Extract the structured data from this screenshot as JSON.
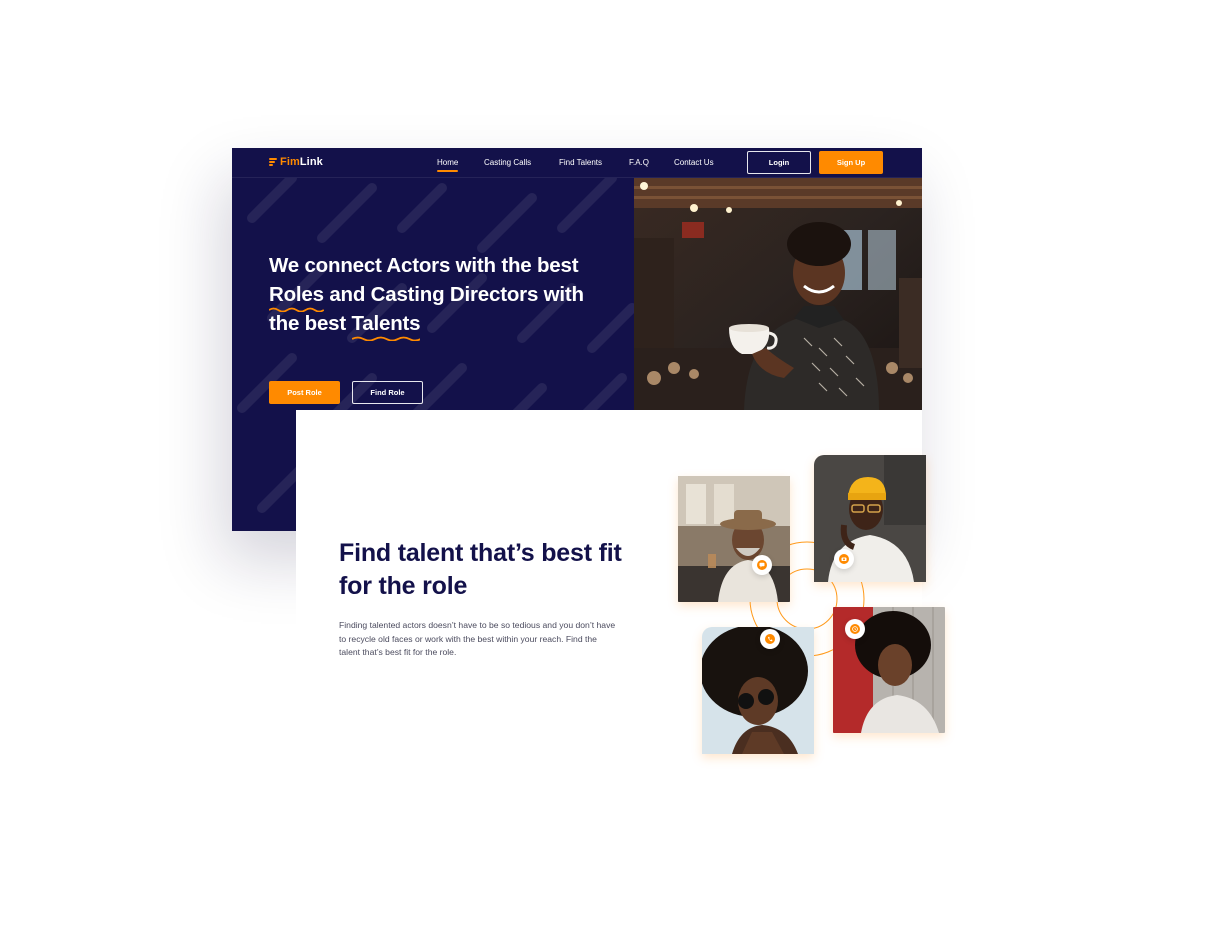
{
  "brand": {
    "name_prefix": "Fim",
    "name_suffix": "Link",
    "accent_color": "#ff8a00",
    "dark_color": "#13114a"
  },
  "nav": {
    "links": [
      {
        "label": "Home",
        "active": true
      },
      {
        "label": "Casting Calls",
        "active": false
      },
      {
        "label": "Find Talents",
        "active": false
      },
      {
        "label": "F.A.Q",
        "active": false
      },
      {
        "label": "Contact Us",
        "active": false
      }
    ],
    "login_label": "Login",
    "signup_label": "Sign Up"
  },
  "hero": {
    "line1": "We connect Actors with the best",
    "roles_word": "Roles",
    "line2_rest": " and Casting Directors with",
    "line3_start": "the best ",
    "talents_word": "Talents",
    "post_role_label": "Post Role",
    "find_role_label": "Find Role"
  },
  "feature": {
    "title": "Find talent that’s best fit for the role",
    "description": "Finding talented actors doesn’t have to be so tedious and you don’t have to recycle old faces or work with the best within your reach. Find the talent that’s best fit for the role."
  },
  "photo_icons": [
    "chat-icon",
    "camera-icon",
    "phone-icon",
    "clock-icon"
  ]
}
